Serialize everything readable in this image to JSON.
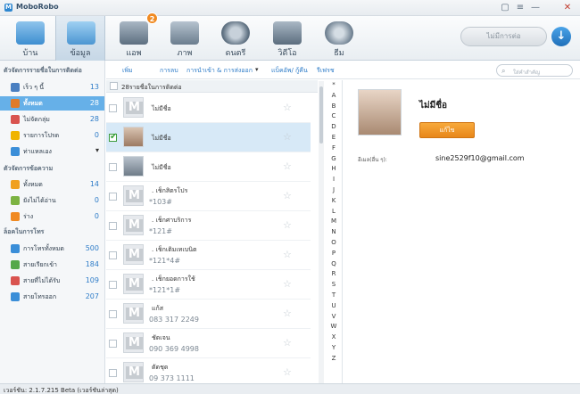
{
  "app": {
    "title": "MoboRobo"
  },
  "window_controls": [
    "▢",
    "≡",
    "—",
    "✕"
  ],
  "nav": {
    "tabs": [
      {
        "label": "บ้าน",
        "icon": "welcome-icon",
        "active": false
      },
      {
        "label": "ข้อมูล",
        "icon": "contacts-card-icon",
        "active": true
      },
      {
        "label": "แอพ",
        "icon": "apps-grid-icon",
        "active": false,
        "badge": "2"
      },
      {
        "label": "ภาพ",
        "icon": "photo-icon",
        "active": false
      },
      {
        "label": "ดนตรี",
        "icon": "music-icon",
        "active": false
      },
      {
        "label": "วิดีโอ",
        "icon": "video-icon",
        "active": false
      },
      {
        "label": "ธีม",
        "icon": "theme-palette-icon",
        "active": false
      }
    ],
    "device_status": "ไม่มีการต่อ",
    "download_icon": "↓"
  },
  "sidebar": {
    "contacts_heading": "ตัวจัดการรายชื่อในการติดต่อ",
    "contact_items": [
      {
        "label": "เร็ว ๆ นี้",
        "count": "13",
        "icon": "recent-icon",
        "color": "#4a7fc1"
      },
      {
        "label": "ทั้งหมด",
        "count": "28",
        "icon": "all-contacts-icon",
        "color": "#e07b2a",
        "active": true
      },
      {
        "label": "ไม่จัดกลุ่ม",
        "count": "28",
        "icon": "ungrouped-icon",
        "color": "#d9534f"
      },
      {
        "label": "รายการโปรด",
        "count": "0",
        "icon": "star-icon",
        "color": "#f0b400"
      },
      {
        "label": "ท่าแหลเอง",
        "count": "",
        "icon": "group-icon",
        "color": "#3a8ed8",
        "chevron": "▾"
      }
    ],
    "messages_heading": "ตัวจัดการข้อความ",
    "message_items": [
      {
        "label": "ทั้งหมด",
        "count": "14",
        "icon": "envelope-icon",
        "color": "#f0a020"
      },
      {
        "label": "ยังไม่ได้อ่าน",
        "count": "0",
        "icon": "unread-icon",
        "color": "#7cb342"
      },
      {
        "label": "ร่าง",
        "count": "0",
        "icon": "draft-icon",
        "color": "#f08a22"
      }
    ],
    "calls_heading": "ล็อคในการโทร",
    "call_items": [
      {
        "label": "การโทรทั้งหมด",
        "count": "500",
        "icon": "phone-icon",
        "color": "#3a8ed8"
      },
      {
        "label": "สายเรียกเข้า",
        "count": "184",
        "icon": "incoming-call-icon",
        "color": "#55a84a"
      },
      {
        "label": "สายที่ไม่ได้รับ",
        "count": "109",
        "icon": "missed-call-icon",
        "color": "#d9534f"
      },
      {
        "label": "สายโทรออก",
        "count": "207",
        "icon": "outgoing-call-icon",
        "color": "#3a8ed8"
      }
    ]
  },
  "toolbar": {
    "add": "เพิ่ม",
    "delete": "การลบ",
    "import_export": "การนำเข้า & การส่งออก",
    "backup_restore": "แบ็คอัพ/ กู้คืน",
    "refresh": "รีเฟรช",
    "search_placeholder": "ใส่คำสำคัญ"
  },
  "list": {
    "header": "28รายชื่อในการติดต่อ",
    "rows": [
      {
        "name": "ไม่มีชื่อ",
        "number": "",
        "avatar": "default",
        "checked": false
      },
      {
        "name": "ไม่มีชื่อ",
        "number": "",
        "avatar": "photo",
        "checked": true,
        "selected": true
      },
      {
        "name": "ไม่มีชื่อ",
        "number": "",
        "avatar": "photo2",
        "checked": false
      },
      {
        "name": ". เช็กสิตรโปร",
        "number": "*103#",
        "avatar": "default",
        "checked": false
      },
      {
        "name": ". เช็กศาบริการ",
        "number": "*121#",
        "avatar": "default",
        "checked": false
      },
      {
        "name": ". เช็กเติมเทเบนิต",
        "number": "*121*4#",
        "avatar": "default",
        "checked": false
      },
      {
        "name": ". เช็กยอดการใช้",
        "number": "*121*1#",
        "avatar": "default",
        "checked": false
      },
      {
        "name": "แก้ส",
        "number": "083 317 2249",
        "avatar": "default",
        "checked": false
      },
      {
        "name": "ชัดเจน",
        "number": "090 369 4998",
        "avatar": "default",
        "checked": false
      },
      {
        "name": "ตัดชุด",
        "number": "09 373 1111",
        "avatar": "default",
        "checked": false
      }
    ]
  },
  "alphabet": [
    "*",
    "A",
    "B",
    "C",
    "D",
    "E",
    "F",
    "G",
    "H",
    "I",
    "J",
    "K",
    "L",
    "M",
    "N",
    "O",
    "P",
    "Q",
    "R",
    "S",
    "T",
    "U",
    "V",
    "W",
    "X",
    "Y",
    "Z"
  ],
  "detail": {
    "name": "ไม่มีชื่อ",
    "edit_button": "แก้ไข",
    "email_label": "อีเมล(อื่น ๆ):",
    "email_value": "sine2529f10@gmail.com"
  },
  "status": {
    "version": "เวอร์ชัน: 2.1.7.215 Beta (เวอร์ชันล่าสุด)"
  }
}
